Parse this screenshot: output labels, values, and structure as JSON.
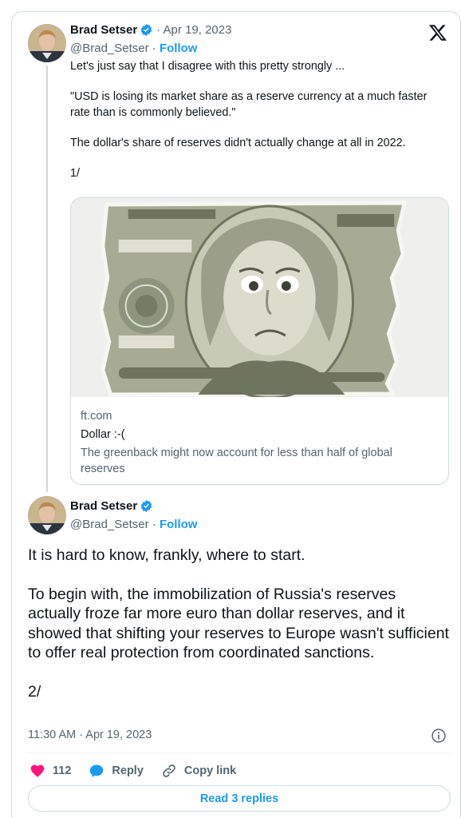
{
  "colors": {
    "accent": "#1d9bf0",
    "text": "#0f1419",
    "secondary": "#536471",
    "like": "#f91880",
    "border": "#cfd9de"
  },
  "tweet1": {
    "author_name": "Brad Setser",
    "date": "· Apr 19, 2023",
    "handle": "@Brad_Setser ·",
    "follow_label": "Follow",
    "text": [
      "Let's just say that I disagree with this pretty strongly ...",
      "\"USD is losing its market share as a reserve currency at a much faster rate than is commonly believed.\"",
      "The dollar's share of reserves didn't actually change at all in 2022.",
      "1/"
    ],
    "link_card": {
      "domain": "ft.com",
      "title": "Dollar :-(",
      "description": "The greenback might now account for less than half of global reserves"
    }
  },
  "tweet2": {
    "author_name": "Brad Setser",
    "handle": "@Brad_Setser ·",
    "follow_label": "Follow",
    "text": [
      "It is hard to know, frankly, where to start.",
      "To begin with, the immobilization of Russia's reserves actually froze far more euro than dollar reserves, and it showed that shifting your reserves to Europe wasn't sufficient to offer real protection from coordinated sanctions.",
      "2/"
    ],
    "timestamp": "11:30 AM · Apr 19, 2023"
  },
  "actions": {
    "likes_count": "112",
    "reply_label": "Reply",
    "copy_link_label": "Copy link"
  },
  "read_replies_label": "Read 3 replies",
  "icons": [
    "x-logo-icon",
    "verified-badge-icon",
    "heart-icon",
    "reply-bubble-icon",
    "link-icon",
    "info-icon"
  ]
}
